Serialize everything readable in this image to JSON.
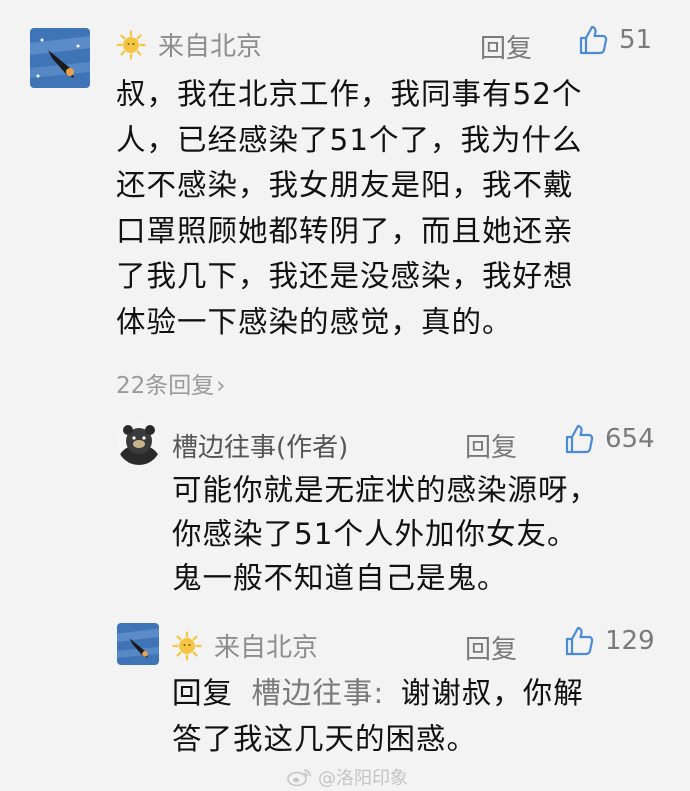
{
  "comment": {
    "location": "来自北京",
    "reply_label": "回复",
    "likes": "51",
    "text_lines": [
      "叔，我在北京工作，我同事有52个",
      "人，已经感染了51个了，我为什么",
      "还不感染，我女朋友是阳，我不戴",
      "口罩照顾她都转阴了，而且她还亲",
      "了我几下，我还是没感染，我好想",
      "体验一下感染的感觉，真的。"
    ],
    "replies_link": "22条回复"
  },
  "author_reply": {
    "name": "槽边往事(作者)",
    "reply_label": "回复",
    "likes": "654",
    "text_lines": [
      "可能你就是无症状的感染源呀，",
      "你感染了51个人外加你女友。",
      "鬼一般不知道自己是鬼。"
    ]
  },
  "sub_reply": {
    "location": "来自北京",
    "reply_label": "回复",
    "likes": "129",
    "prefix": "回复",
    "target": "槽边往事:",
    "text_line1": "谢谢叔，你解",
    "text_line2": "答了我这几天的困惑。"
  },
  "watermark": "@洛阳印象",
  "colors": {
    "background": "#f3f3f3",
    "text": "#111111",
    "muted": "#8d8d8d",
    "avatar_bg": "#3f74b7",
    "sun": "#f4c542"
  },
  "icons": [
    "sun-icon",
    "thumbs-up-icon",
    "chevron-right-icon",
    "weibo-icon"
  ]
}
